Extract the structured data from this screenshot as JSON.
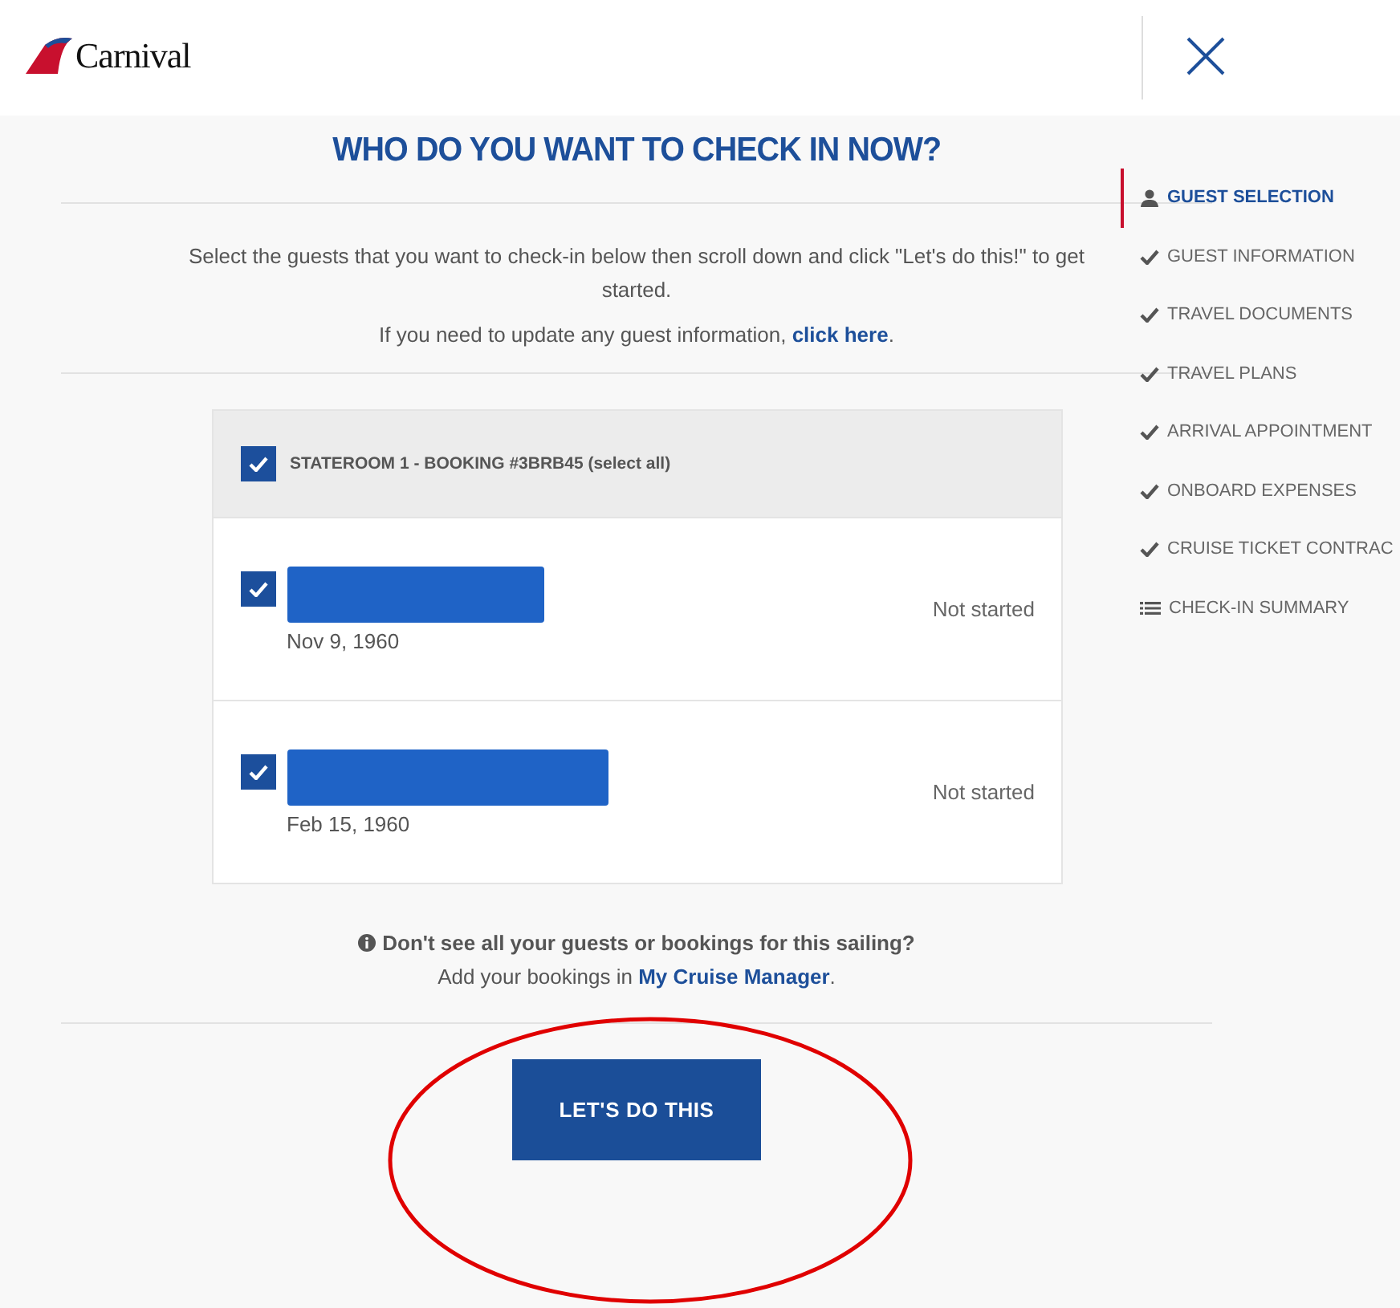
{
  "header": {
    "logo": "Carnival"
  },
  "title": "WHO DO YOU WANT TO CHECK IN NOW?",
  "intro": "Select the guests that you want to check-in below then scroll down and click \"Let's do this!\" to get started.",
  "update_note": {
    "text": "If you need to update any guest information, ",
    "link": "click here",
    "after": "."
  },
  "steps": [
    {
      "label": "GUEST SELECTION",
      "kind": "person",
      "selected": true
    },
    {
      "label": "GUEST INFORMATION",
      "kind": "check",
      "selected": false
    },
    {
      "label": "TRAVEL DOCUMENTS",
      "kind": "check",
      "selected": false
    },
    {
      "label": "TRAVEL PLANS",
      "kind": "check",
      "selected": false
    },
    {
      "label": "ARRIVAL APPOINTMENT",
      "kind": "check",
      "selected": false
    },
    {
      "label": "ONBOARD EXPENSES",
      "kind": "check",
      "selected": false
    },
    {
      "label": "CRUISE TICKET CONTRAC",
      "kind": "check",
      "selected": false
    },
    {
      "label": "CHECK-IN SUMMARY",
      "kind": "list",
      "selected": false
    }
  ],
  "booking": {
    "label": "STATEROOM 1 - BOOKING #3BRB45 (select all)",
    "checked": true,
    "guests": [
      {
        "name_redacted": true,
        "date": "Nov 9, 1960",
        "status": "Not started",
        "checked": true
      },
      {
        "name_redacted": true,
        "date": "Feb 15, 1960",
        "status": "Not started",
        "checked": true
      }
    ]
  },
  "help": {
    "question": "Don't see all your guests or bookings for this sailing?",
    "text": "Add your bookings in ",
    "link": "My Cruise Manager",
    "after": "."
  },
  "button": "LET'S DO THIS"
}
